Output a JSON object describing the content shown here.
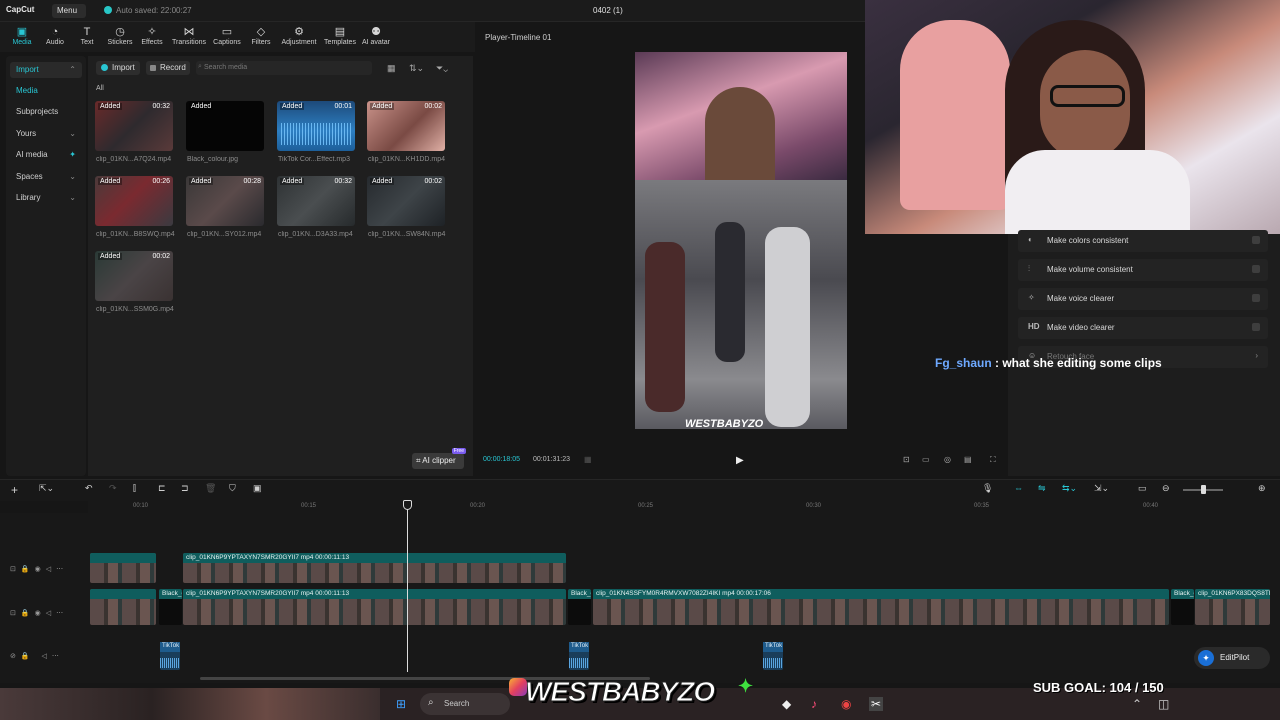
{
  "app": {
    "name": "CapCut",
    "menu": "Menu",
    "autosave": "Auto saved: 22:00:27",
    "project": "0402 (1)"
  },
  "toolbar": {
    "tabs": [
      {
        "label": "Media",
        "icon": "media-icon"
      },
      {
        "label": "Audio",
        "icon": "audio-icon"
      },
      {
        "label": "Text",
        "icon": "text-icon"
      },
      {
        "label": "Stickers",
        "icon": "stickers-icon"
      },
      {
        "label": "Effects",
        "icon": "effects-icon"
      },
      {
        "label": "Transitions",
        "icon": "transitions-icon"
      },
      {
        "label": "Captions",
        "icon": "captions-icon"
      },
      {
        "label": "Filters",
        "icon": "filters-icon"
      },
      {
        "label": "Adjustment",
        "icon": "adjustment-icon"
      },
      {
        "label": "Templates",
        "icon": "templates-icon"
      },
      {
        "label": "AI avatar",
        "icon": "ai-avatar-icon"
      }
    ],
    "active": "Media"
  },
  "sidebar": {
    "items": [
      {
        "label": "Import",
        "chevron": true
      },
      {
        "label": "Media",
        "chevron": false
      },
      {
        "label": "Subprojects",
        "chevron": false
      },
      {
        "label": "Yours",
        "chevron": true
      },
      {
        "label": "AI media",
        "chevron": true
      },
      {
        "label": "Spaces",
        "chevron": true
      },
      {
        "label": "Library",
        "chevron": true
      }
    ]
  },
  "media": {
    "import_label": "Import",
    "record_label": "Record",
    "search_placeholder": "Search media",
    "filter_label": "All",
    "ai_clipper": "AI clipper",
    "free_badge": "Free",
    "items": [
      {
        "name": "clip_01KN...A7Q24.mp4",
        "badge": "Added",
        "duration": "00:32"
      },
      {
        "name": "Black_colour.jpg",
        "badge": "Added",
        "duration": ""
      },
      {
        "name": "TikTok Cor...Effect.mp3",
        "badge": "Added",
        "duration": "00:01"
      },
      {
        "name": "clip_01KN...KH1DD.mp4",
        "badge": "Added",
        "duration": "00:02"
      },
      {
        "name": "clip_01KN...B8SWQ.mp4",
        "badge": "Added",
        "duration": "00:26"
      },
      {
        "name": "clip_01KN...SY012.mp4",
        "badge": "Added",
        "duration": "00:28"
      },
      {
        "name": "clip_01KN...D3A33.mp4",
        "badge": "Added",
        "duration": "00:32"
      },
      {
        "name": "clip_01KN...SW84N.mp4",
        "badge": "Added",
        "duration": "00:02"
      },
      {
        "name": "clip_01KN...SSM0G.mp4",
        "badge": "Added",
        "duration": "00:02"
      }
    ]
  },
  "player": {
    "title": "Player-Timeline 01",
    "current_time": "00:00:18:05",
    "total_time": "00:01:31:23",
    "watermark": "WESTBABYZO"
  },
  "enhance": {
    "rows": [
      {
        "label": "Make colors consistent",
        "icon": "palette-icon"
      },
      {
        "label": "Make volume consistent",
        "icon": "sliders-icon"
      },
      {
        "label": "Make voice clearer",
        "icon": "sparkle-icon"
      },
      {
        "label": "Make video clearer",
        "icon": "hd-icon"
      },
      {
        "label": "Retouch face",
        "icon": "face-icon"
      }
    ]
  },
  "chat": {
    "user": "Fg_shaun",
    "sep": " : ",
    "message": "what she editing some clips"
  },
  "timeline": {
    "ruler": [
      "00:10",
      "00:15",
      "00:20",
      "00:25",
      "00:30",
      "00:35",
      "00:40"
    ],
    "clips": {
      "top_track_label": "clip_01KN6P9YPTAXYN7SMR20GYII7 mp4   00:00:11:13",
      "main_a": "clip_01KN6P9YPTAXYN7SMR20GYII7 mp4   00:00:11:13",
      "main_b": "clip_01KN4SSFYM0R4RMVXW7082ZI4IKI mp4   00:00:17:06",
      "main_c": "clip_01KN6PX83DQS8TF",
      "black_label": "Black_c",
      "audio_label": "TikTok"
    },
    "edit_pilot": "EditPilot"
  },
  "overlay": {
    "watermark": "WESTBABYZO",
    "sub_goal": "SUB GOAL: 104 / 150",
    "taskbar_search": "Search"
  },
  "colors": {
    "accent": "#29c6d3",
    "clip_label": "#0f5d5d",
    "chat_user": "#6ea9ff"
  }
}
